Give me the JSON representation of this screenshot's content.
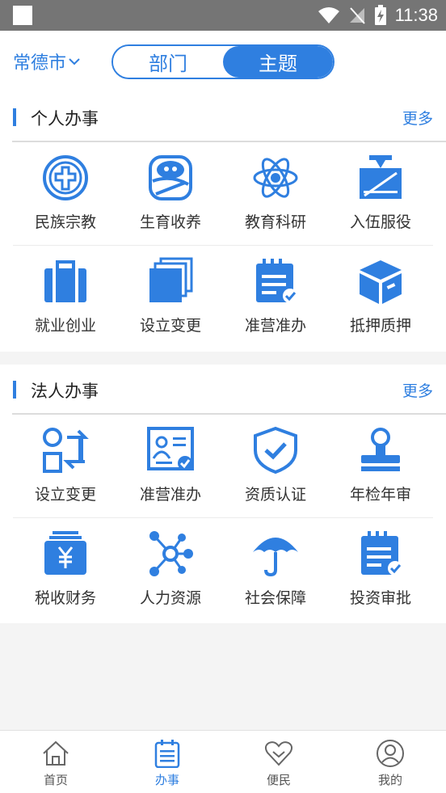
{
  "status": {
    "time": "11:38"
  },
  "header": {
    "city": "常德市",
    "tabs": [
      {
        "label": "部门"
      },
      {
        "label": "主题"
      }
    ],
    "active_tab": "主题"
  },
  "personal": {
    "title": "个人办事",
    "more": "更多",
    "items": [
      {
        "label": "民族宗教",
        "icon": "cross-circle-icon"
      },
      {
        "label": "生育收养",
        "icon": "baby-icon"
      },
      {
        "label": "教育科研",
        "icon": "atom-icon"
      },
      {
        "label": "入伍服役",
        "icon": "military-cap-icon"
      },
      {
        "label": "就业创业",
        "icon": "briefcase-icon"
      },
      {
        "label": "设立变更",
        "icon": "stacked-pages-icon"
      },
      {
        "label": "准营准办",
        "icon": "checklist-icon"
      },
      {
        "label": "抵押质押",
        "icon": "box-icon"
      }
    ]
  },
  "legal": {
    "title": "法人办事",
    "more": "更多",
    "items": [
      {
        "label": "设立变更",
        "icon": "swap-icon"
      },
      {
        "label": "准营准办",
        "icon": "certificate-icon"
      },
      {
        "label": "资质认证",
        "icon": "shield-check-icon"
      },
      {
        "label": "年检年审",
        "icon": "stamp-icon"
      },
      {
        "label": "税收财务",
        "icon": "yen-icon"
      },
      {
        "label": "人力资源",
        "icon": "network-icon"
      },
      {
        "label": "社会保障",
        "icon": "umbrella-icon"
      },
      {
        "label": "投资审批",
        "icon": "notepad-check-icon"
      }
    ]
  },
  "bottomnav": {
    "items": [
      {
        "label": "首页",
        "icon": "home-icon"
      },
      {
        "label": "办事",
        "icon": "clipboard-icon"
      },
      {
        "label": "便民",
        "icon": "heart-icon"
      },
      {
        "label": "我的",
        "icon": "user-icon"
      }
    ],
    "active": "办事"
  },
  "colors": {
    "accent": "#2f7fe0",
    "statusbar": "#757575"
  }
}
